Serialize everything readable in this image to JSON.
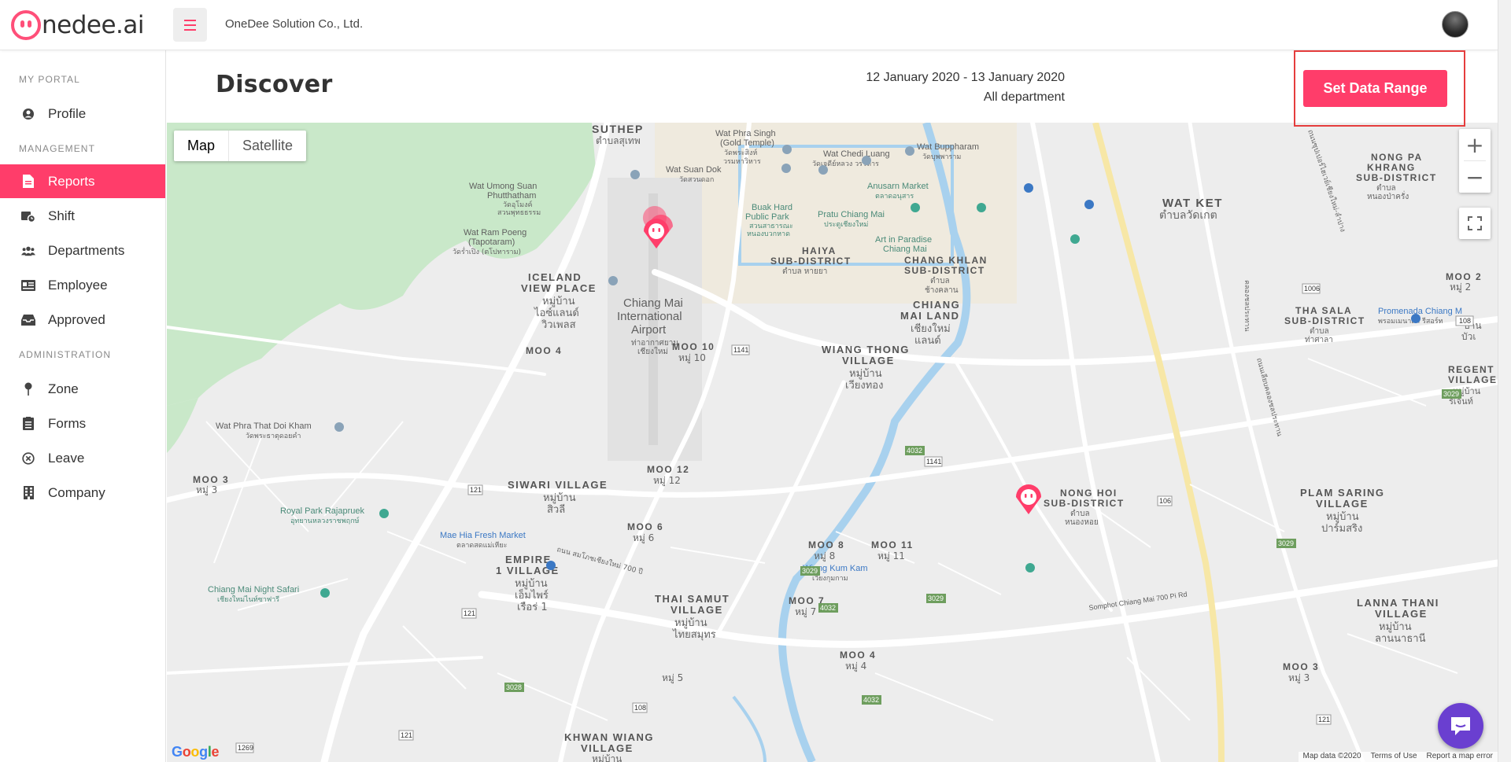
{
  "app": {
    "logo_text": "nedee.ai",
    "company_name": "OneDee Solution Co., Ltd."
  },
  "sidebar": {
    "sections": {
      "portal": "MY PORTAL",
      "management": "MANAGEMENT",
      "administration": "ADMINISTRATION"
    },
    "items": [
      {
        "label": "Profile",
        "icon": "user-icon"
      },
      {
        "label": "Reports",
        "icon": "report-icon",
        "active": true
      },
      {
        "label": "Shift",
        "icon": "shift-icon"
      },
      {
        "label": "Departments",
        "icon": "users-icon"
      },
      {
        "label": "Employee",
        "icon": "id-card-icon"
      },
      {
        "label": "Approved",
        "icon": "inbox-icon"
      },
      {
        "label": "Zone",
        "icon": "pin-icon"
      },
      {
        "label": "Forms",
        "icon": "form-icon"
      },
      {
        "label": "Leave",
        "icon": "cancel-icon"
      },
      {
        "label": "Company",
        "icon": "building-icon"
      }
    ]
  },
  "page": {
    "title": "Discover",
    "date_range": "12 January 2020 - 13 January 2020",
    "department": "All department",
    "set_range_button": "Set Data Range"
  },
  "map": {
    "type_options": [
      "Map",
      "Satellite"
    ],
    "selected_type": "Map",
    "zoom_in": "+",
    "zoom_out": "−",
    "attribution": [
      "Map data ©2020",
      "Terms of Use",
      "Report a map error"
    ],
    "google_logo": "Google",
    "colors": {
      "road": "#ffffff",
      "highway": "#f7e7a6",
      "water": "#a8d1ee",
      "park": "#c9e8c9",
      "marker": "#ff3d6a"
    },
    "labels": {
      "suthep": "SUTHEP",
      "suthep_th": "ตำบลสุเทพ",
      "wat_phra_singh": "Wat Phra Singh",
      "gold_temple": "(Gold Temple)",
      "wat_phra_singh_th": "วัดพระสิงห์",
      "wat_phra_singh_th2": "วรมหาวิหาร",
      "wat_chedi_luang": "Wat Chedi Luang",
      "wat_chedi_luang_th": "วัดเจดีย์หลวง วรวิหาร",
      "wat_buppharam": "Wat Buppharam",
      "wat_buppharam_th": "วัดบุพพาราม",
      "wat_ket": "WAT KET",
      "wat_ket_th": "ตำบลวัดเกต",
      "nong_pa_khrang": "NONG PA",
      "nong_pa_khrang2": "KHRANG",
      "nong_pa_khrang3": "SUB-DISTRICT",
      "nong_pa_khrang_th": "ตำบล",
      "nong_pa_khrang_th2": "หนองป่าครั่ง",
      "wat_suan_dok": "Wat Suan Dok",
      "wat_suan_dok_th": "วัดสวนดอก",
      "wat_umong": "Wat Umong Suan",
      "phutthatham": "Phutthatham",
      "wat_umong_th": "วัดอุโมงค์",
      "wat_umong_th2": "สวนพุทธธรรม",
      "buak_hard": "Buak Hard",
      "public_park": "Public Park",
      "buak_hard_th": "สวนสาธารณะ",
      "buak_hard_th2": "หนองบวกหาด",
      "anusarn": "Anusarn Market",
      "anusarn_th": "ตลาดอนุสาร",
      "pratu_chiang_mai": "Pratu Chiang Mai",
      "pratu_chiang_mai_th": "ประตูเชียงใหม่",
      "haiya": "HAIYA",
      "haiya_sub": "SUB-DISTRICT",
      "haiya_th": "ตำบล หายยา",
      "art_in_paradise": "Art in Paradise",
      "art_in_paradise2": "Chiang Mai",
      "chang_khlan": "CHANG KHLAN",
      "chang_khlan_sub": "SUB-DISTRICT",
      "chang_khlan_th": "ตำบล",
      "chang_khlan_th2": "ช้างคลาน",
      "chiang_mai_land": "CHIANG",
      "chiang_mai_land2": "MAI LAND",
      "chiang_mai_land_th": "เชียงใหม่",
      "chiang_mai_land_th2": "แลนด์",
      "wat_ram_poeng": "Wat Ram Poeng",
      "taptaram": "(Tapotaram)",
      "wat_ram_poeng_th": "วัดร่ำเปิง (ตโปทาราม)",
      "iceland": "ICELAND",
      "view_place": "VIEW PLACE",
      "iceland_th": "หมู่บ้าน",
      "iceland_th2": "ไอซ์แลนด์",
      "iceland_th3": "วิวเพลส",
      "airport": "Chiang Mai",
      "airport2": "International",
      "airport3": "Airport",
      "airport_th": "ท่าอากาศยาน",
      "airport_th2": "เชียงใหม่",
      "moo_4": "MOO 4",
      "moo_10": "MOO 10",
      "moo_10_th": "หมู่ 10",
      "wiang_thong": "WIANG THONG",
      "wiang_thong2": "VILLAGE",
      "wiang_thong_th": "หมู่บ้าน",
      "wiang_thong_th2": "เวียงทอง",
      "tha_sala": "THA SALA",
      "tha_sala_sub": "SUB-DISTRICT",
      "tha_sala_th": "ตำบล",
      "tha_sala_th2": "ท่าศาลา",
      "promenada": "Promenada Chiang M",
      "promenada_th": "พรอมเมนาดา รีสอร์ท",
      "moo_2": "MOO 2",
      "moo_2_th": "หมู่ 2",
      "regent": "REGENT",
      "regent2": "VILLAGE",
      "regent_th": "หมู่บ้าน",
      "regent_th2": "รีเจ้นท์",
      "baan_bua": "บ้าน",
      "baan_bua2": "บัวเ",
      "wat_phra_that_doi_kham": "Wat Phra That Doi Kham",
      "doi_kham_th": "วัดพระธาตุดอยคำ",
      "moo_3": "MOO 3",
      "moo_3_th": "หมู่ 3",
      "moo_12": "MOO 12",
      "moo_12_th": "หมู่ 12",
      "siwari": "SIWARI VILLAGE",
      "siwari_th": "หมู่บ้าน",
      "siwari_th2": "สิวลี",
      "royal_park": "Royal Park Rajapruek",
      "royal_park_th": "อุทยานหลวงราชพฤกษ์",
      "mae_hia": "Mae Hia Fresh Market",
      "mae_hia_th": "ตลาดสดแม่เหียะ",
      "moo_6": "MOO 6",
      "moo_6_th": "หมู่ 6",
      "nong_hoi": "NONG HOI",
      "nong_hoi_sub": "SUB-DISTRICT",
      "nong_hoi_th": "ตำบล",
      "nong_hoi_th2": "หนองหอย",
      "plam_saring": "PLAM SARING",
      "plam_saring2": "VILLAGE",
      "plam_saring_th": "หมู่บ้าน",
      "plam_saring_th2": "ปาร์มสริง",
      "road_700_th": "ถนน สมโภชเชียงใหม่ 700 ปี",
      "empire": "EMPIRE",
      "empire2": "1 VILLAGE",
      "empire_th": "หมู่บ้าน",
      "empire_th2": "เอ็มไพร์",
      "empire_th3": "เรือร่ 1",
      "moo_8": "MOO 8",
      "moo_8_th": "หมู่ 8",
      "moo_11": "MOO 11",
      "moo_11_th": "หมู่ 11",
      "wiang_kum_kam": "Wiang Kum Kam",
      "wiang_kum_kam_th": "เวียงกุมกาม",
      "somphot_road": "Somphot Chiang Mai 700 Pi Rd",
      "night_safari": "Chiang Mai Night Safari",
      "night_safari_th": "เชียงใหม่ไนท์ซาฟารี",
      "thai_samut": "THAI SAMUT",
      "thai_samut2": "VILLAGE",
      "thai_samut_th": "หมู่บ้าน",
      "thai_samut_th2": "ไทยสมุทร",
      "moo_7": "MOO 7",
      "moo_7_th": "หมู่ 7",
      "lanna_thani": "LANNA THANI",
      "lanna_thani2": "VILLAGE",
      "lanna_thani_th": "หมู่บ้าน",
      "lanna_thani_th2": "ลานนาธานี",
      "moo_4b": "MOO 4",
      "moo_4b_th": "หมู่ 4",
      "moo_5_th": "หมู่ 5",
      "moo_3b": "MOO 3",
      "moo_3b_th": "หมู่ 3",
      "khwan_wiang": "KHWAN WIANG",
      "khwan_wiang2": "VILLAGE",
      "khwan_wiang_th": "หมู่บ้าน",
      "canal_th": "คลองชลประทาน",
      "canal_th2": "ถนนเลียบคลองชลประทาน",
      "super_hwy_th": "ถนนซุปเปอร์ไฮเวย์เชียงใหม่-ลำปาง"
    },
    "shields": [
      "1141",
      "1006",
      "108",
      "121",
      "4032",
      "1141",
      "106",
      "3029",
      "3029",
      "3029",
      "4032",
      "121",
      "3028",
      "108",
      "4032",
      "1269",
      "121",
      "121",
      "3029"
    ]
  }
}
